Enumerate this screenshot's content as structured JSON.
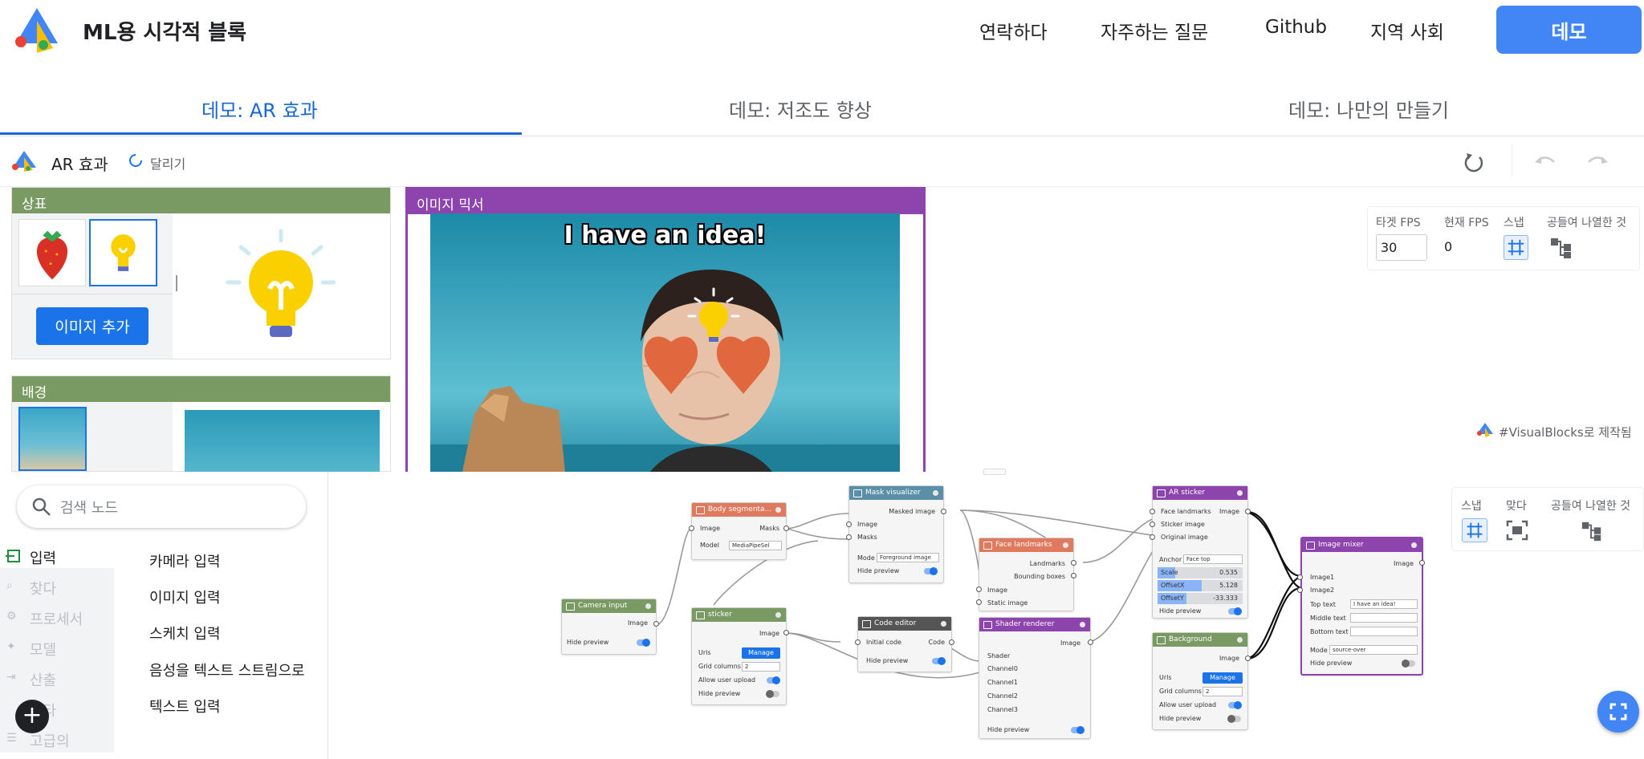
{
  "header": {
    "brand": "ML용 시각적 블록",
    "nav": [
      "연락하다",
      "자주하는 질문",
      "Github",
      "지역 사회"
    ],
    "demo_button": "데모"
  },
  "tabs": [
    "데모: AR 효과",
    "데모: 저조도 향상",
    "데모: 나만의 만들기"
  ],
  "toolbar": {
    "title": "AR 효과",
    "run_label": "달리기"
  },
  "panels": {
    "logo_panel_title": "상표",
    "add_image_button": "이미지 추가",
    "background_panel_title": "배경",
    "mixer_title": "이미지 믹서",
    "preview_caption": "I have an idea!"
  },
  "settings": {
    "target_fps_label": "타겟 FPS",
    "target_fps_value": "30",
    "current_fps_label": "현재 FPS",
    "current_fps_value": "0",
    "snap_label": "스냅",
    "arrange_label": "공들여 나열한 것"
  },
  "made_with": "#VisualBlocks로 제작됨",
  "graph_controls": {
    "snap": "스냅",
    "fit": "맞다",
    "arrange": "공들여 나열한 것"
  },
  "search": {
    "placeholder": "검색 노드"
  },
  "categories": [
    "입력",
    "찾다",
    "프로세서",
    "모델",
    "산출",
    "기타",
    "고급의"
  ],
  "subitems": [
    "카메라 입력",
    "이미지 입력",
    "스케치 입력",
    "음성을 텍스트 스트림으로",
    "텍스트 입력"
  ],
  "nodes": {
    "camera": {
      "title": "Camera input",
      "out": "Image",
      "hide": "Hide preview"
    },
    "body": {
      "title": "Body segmenta...",
      "in": "Image",
      "out": "Masks",
      "model_label": "Model",
      "model_value": "MediaPipeSel"
    },
    "mask": {
      "title": "Mask visualizer",
      "out": "Masked image",
      "in1": "Image",
      "in2": "Masks",
      "mode_label": "Mode",
      "mode_value": "Foreground image",
      "hide": "Hide preview"
    },
    "sticker": {
      "title": "sticker",
      "out": "Image",
      "urls": "Urls",
      "manage": "Manage",
      "grid": "Grid columns",
      "grid_value": "2",
      "upload": "Allow user upload",
      "hide": "Hide preview"
    },
    "code": {
      "title": "Code editor",
      "in": "Initial code",
      "out": "Code",
      "hide": "Hide preview"
    },
    "face": {
      "title": "Face landmarks",
      "out1": "Landmarks",
      "out2": "Bounding boxes",
      "in1": "Image",
      "in2": "Static image"
    },
    "shader": {
      "title": "Shader renderer",
      "out": "Image",
      "in1": "Shader",
      "in2": "Channel0",
      "in3": "Channel1",
      "in4": "Channel2",
      "in5": "Channel3",
      "hide": "Hide preview"
    },
    "ar": {
      "title": "AR sticker",
      "in1": "Face landmarks",
      "out": "Image",
      "in2": "Sticker image",
      "in3": "Original image",
      "anchor_label": "Anchor",
      "anchor_value": "Face top",
      "scale_label": "Scale",
      "scale_value": "0.535",
      "ox_label": "OffsetX",
      "ox_value": "5.128",
      "oy_label": "OffsetY",
      "oy_value": "-33.333",
      "hide": "Hide preview"
    },
    "bg": {
      "title": "Background",
      "out": "Image",
      "urls": "Urls",
      "manage": "Manage",
      "grid": "Grid columns",
      "grid_value": "2",
      "upload": "Allow user upload",
      "hide": "Hide preview"
    },
    "mixer": {
      "title": "Image mixer",
      "out": "Image",
      "in1": "Image1",
      "in2": "Image2",
      "top_label": "Top text",
      "top_value": "I have an idea!",
      "mid_label": "Middle text",
      "bot_label": "Bottom text",
      "mode_label": "Mode",
      "mode_value": "source-over",
      "hide": "Hide preview"
    }
  },
  "colors": {
    "accent": "#4285f4",
    "tab_active": "#1967d2",
    "panel_green": "#7a9a63",
    "panel_purple": "#8e44ad",
    "node_orange": "#e07a5f",
    "node_blue": "#5b8fa8",
    "node_green": "#7a9a63",
    "node_dark": "#555555",
    "node_purple": "#8e44ad"
  },
  "icons": [
    "app-logo-icon",
    "spinner-icon",
    "reset-icon",
    "undo-icon",
    "redo-icon",
    "grid-icon",
    "tree-icon",
    "fit-icon",
    "search-icon",
    "plus-icon",
    "fullscreen-icon"
  ]
}
